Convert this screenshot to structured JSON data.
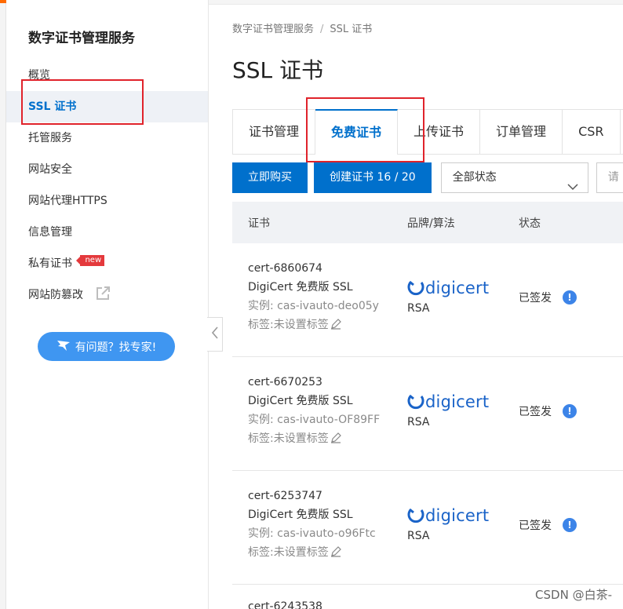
{
  "sidebar": {
    "title": "数字证书管理服务",
    "items": [
      {
        "label": "概览"
      },
      {
        "label": "SSL 证书"
      },
      {
        "label": "托管服务"
      },
      {
        "label": "网站安全"
      },
      {
        "label": "网站代理HTTPS"
      },
      {
        "label": "信息管理"
      },
      {
        "label": "私有证书",
        "badge": "new"
      },
      {
        "label": "网站防篡改"
      }
    ],
    "help_button": "有问题？找专家!"
  },
  "breadcrumb": {
    "root": "数字证书管理服务",
    "separator": "/",
    "current": "SSL 证书"
  },
  "page_title": "SSL 证书",
  "tabs": [
    "证书管理",
    "免费证书",
    "上传证书",
    "订单管理",
    "CSR"
  ],
  "active_tab": "免费证书",
  "toolbar": {
    "buy_label": "立即购买",
    "create_label": "创建证书 16 / 20",
    "status_select": "全部状态",
    "search_placeholder": "请"
  },
  "table": {
    "headers": [
      "证书",
      "品牌/算法",
      "状态"
    ],
    "rows": [
      {
        "id": "cert-6860674",
        "name": "DigiCert 免费版 SSL",
        "instance": "实例: cas-ivauto-deo05y",
        "tag": "标签:未设置标签",
        "brand": "digicert",
        "algo": "RSA",
        "status": "已签发"
      },
      {
        "id": "cert-6670253",
        "name": "DigiCert 免费版 SSL",
        "instance": "实例: cas-ivauto-OF89FF",
        "tag": "标签:未设置标签",
        "brand": "digicert",
        "algo": "RSA",
        "status": "已签发"
      },
      {
        "id": "cert-6253747",
        "name": "DigiCert 免费版 SSL",
        "instance": "实例: cas-ivauto-o96Ftc",
        "tag": "标签:未设置标签",
        "brand": "digicert",
        "algo": "RSA",
        "status": "已签发"
      }
    ],
    "partial_row_id": "cert-6243538"
  },
  "watermark": "CSDN @白茶-",
  "colors": {
    "accent": "#0070cc",
    "annotation": "#e0232b",
    "help_button": "#3f96f1",
    "new_badge": "#e4393c",
    "digicert": "#1a63c8"
  },
  "icons": {
    "external": "external-link-icon",
    "help": "chat-bird-icon",
    "collapse": "chevron-left-icon",
    "select": "chevron-down-icon",
    "edit": "pencil-icon",
    "status": "info-icon"
  }
}
